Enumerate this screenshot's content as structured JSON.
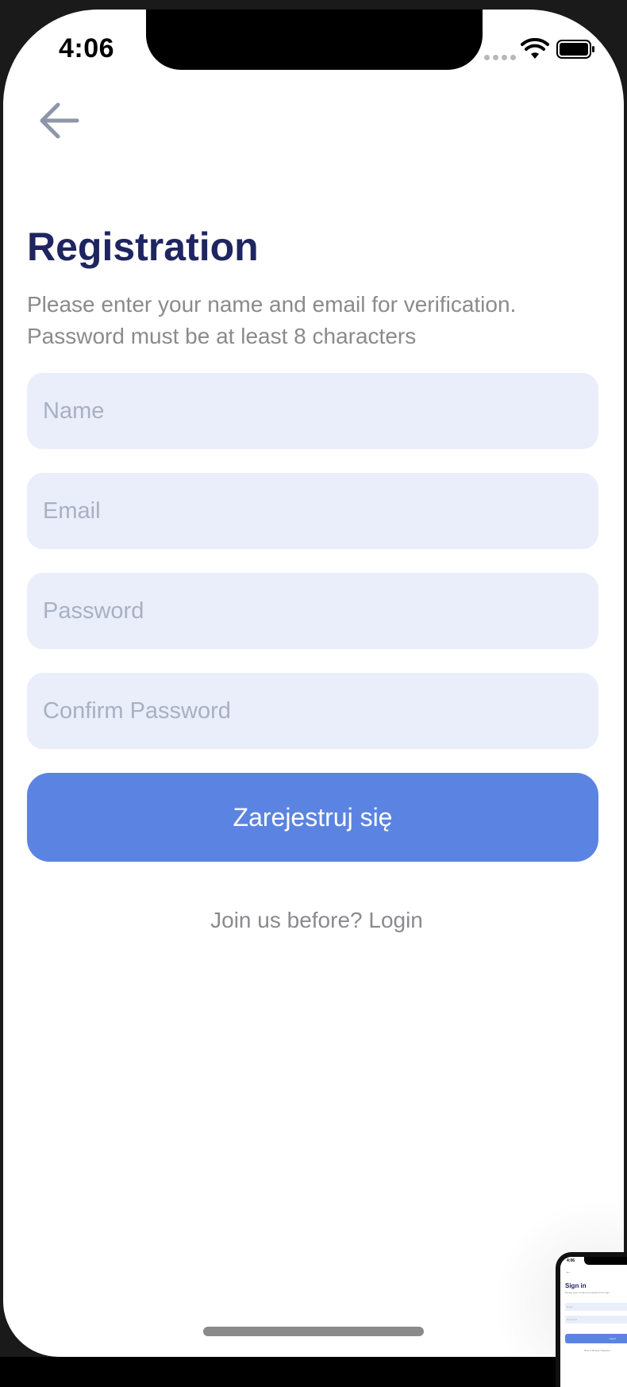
{
  "status_bar": {
    "time": "4:06"
  },
  "header": {
    "back_icon": "arrow-left-icon"
  },
  "main": {
    "title": "Registration",
    "subtitle_line1": "Please enter your name and email for verification.",
    "subtitle_line2": "Password must be at least 8 characters",
    "fields": {
      "name_placeholder": "Name",
      "email_placeholder": "Email",
      "password_placeholder": "Password",
      "confirm_password_placeholder": "Confirm Password"
    },
    "register_button_label": "Zarejestruj się",
    "login_link": "Join us before? Login"
  },
  "preview": {
    "time": "4:06",
    "title": "Sign in",
    "subtitle": "Please enter email and password for login",
    "email_placeholder": "Email",
    "password_placeholder": "Password",
    "button_label": "Log in",
    "link": "New to Bookly? Register"
  },
  "colors": {
    "title": "#1f2560",
    "accent": "#5b84e2",
    "field_background": "#eaeefa",
    "muted_text": "#8a8a8f"
  }
}
